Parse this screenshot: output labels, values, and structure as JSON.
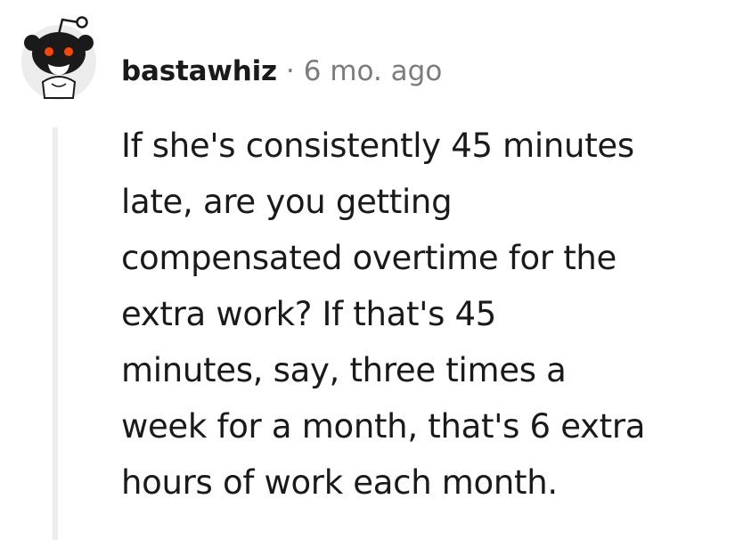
{
  "comment": {
    "username": "bastawhiz",
    "separator": "·",
    "time": "6 mo. ago",
    "avatar_icon": "snoo-avatar-icon",
    "body_lines": [
      "If she's consistently 45 minutes",
      "late, are you getting",
      "compensated overtime for the",
      "extra work? If that's 45",
      "minutes, say, three times a",
      "week for a month, that's 6 extra",
      "hours of work each month."
    ]
  }
}
